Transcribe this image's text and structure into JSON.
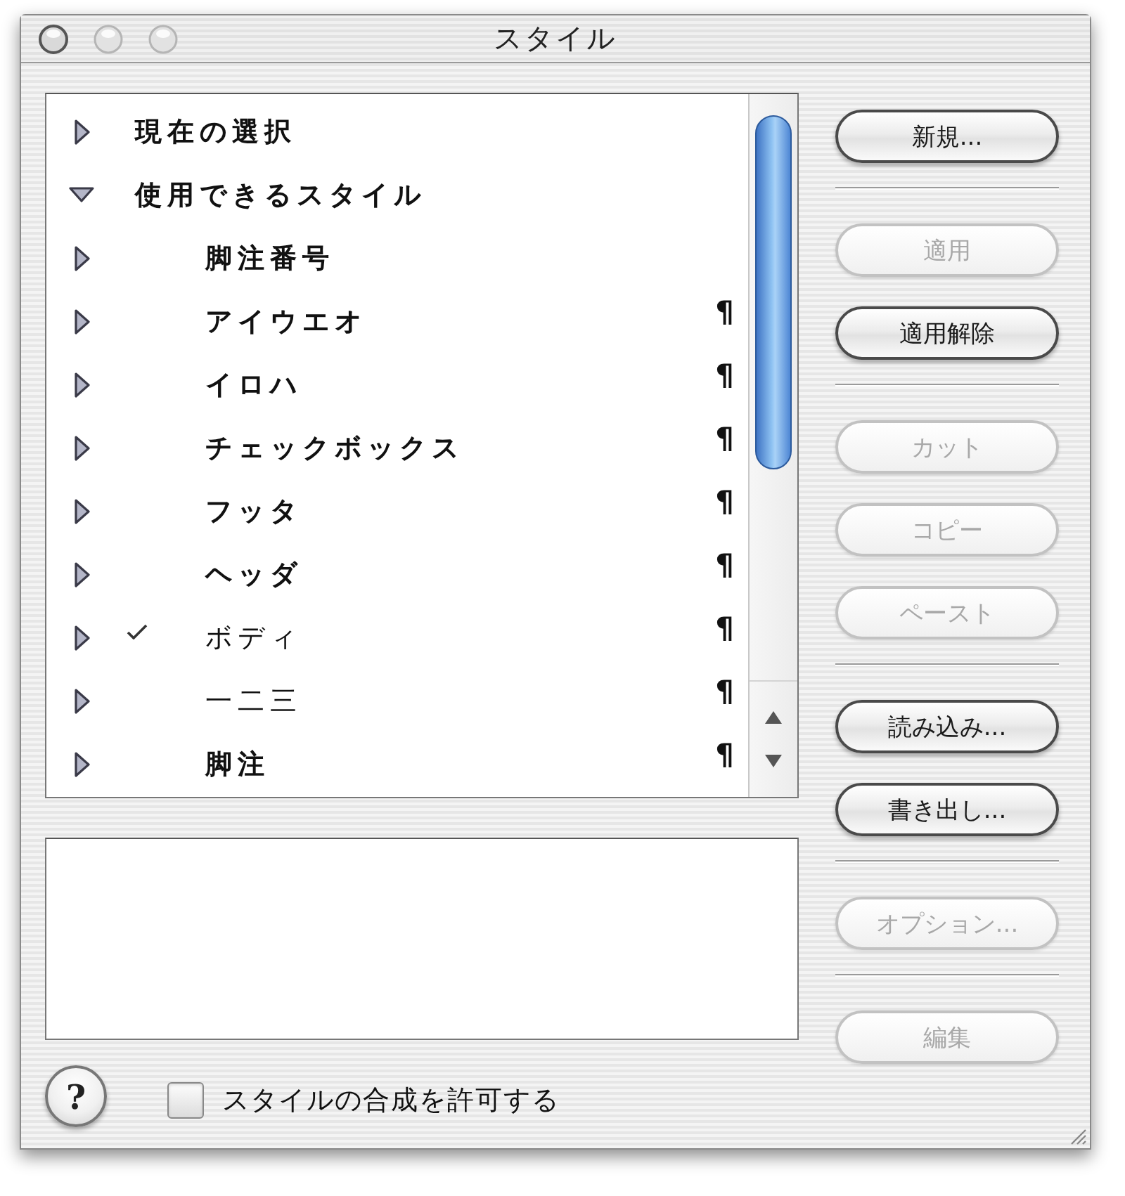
{
  "window": {
    "title": "スタイル"
  },
  "style_list": {
    "items": [
      {
        "label": "現在の選択",
        "expanded": false,
        "bold": true
      },
      {
        "label": "使用できるスタイル",
        "expanded": true,
        "bold": true,
        "children": [
          {
            "label": "脚注番号",
            "expanded": false,
            "bold": true,
            "checked": false
          },
          {
            "label": "アイウエオ",
            "expanded": false,
            "bold": true,
            "checked": false,
            "mark": "¶"
          },
          {
            "label": "イロハ",
            "expanded": false,
            "bold": true,
            "checked": false,
            "mark": "¶"
          },
          {
            "label": "チェックボックス",
            "expanded": false,
            "bold": true,
            "checked": false,
            "mark": "¶"
          },
          {
            "label": "フッタ",
            "expanded": false,
            "bold": true,
            "checked": false,
            "mark": "¶"
          },
          {
            "label": "ヘッダ",
            "expanded": false,
            "bold": true,
            "checked": false,
            "mark": "¶"
          },
          {
            "label": "ボディ",
            "expanded": false,
            "bold": false,
            "checked": true,
            "mark": "¶"
          },
          {
            "label": "一二三",
            "expanded": false,
            "bold": false,
            "checked": false,
            "mark": "¶"
          },
          {
            "label": "脚注",
            "expanded": false,
            "bold": true,
            "checked": false,
            "mark": "¶"
          }
        ]
      }
    ]
  },
  "button_groups": [
    {
      "buttons": [
        {
          "label": "新規...",
          "disabled": false
        }
      ]
    },
    {
      "buttons": [
        {
          "label": "適用",
          "disabled": true
        },
        {
          "label": "適用解除",
          "disabled": false
        }
      ]
    },
    {
      "buttons": [
        {
          "label": "カット",
          "disabled": true
        },
        {
          "label": "コピー",
          "disabled": true
        },
        {
          "label": "ペースト",
          "disabled": true
        }
      ]
    },
    {
      "buttons": [
        {
          "label": "読み込み...",
          "disabled": false
        },
        {
          "label": "書き出し...",
          "disabled": false
        }
      ]
    },
    {
      "buttons": [
        {
          "label": "オプション...",
          "disabled": true
        }
      ]
    },
    {
      "buttons": [
        {
          "label": "編集",
          "disabled": true
        }
      ]
    }
  ],
  "help_button": {
    "label": "?"
  },
  "option_checkbox": {
    "label": "スタイルの合成を許可する",
    "checked": false
  }
}
